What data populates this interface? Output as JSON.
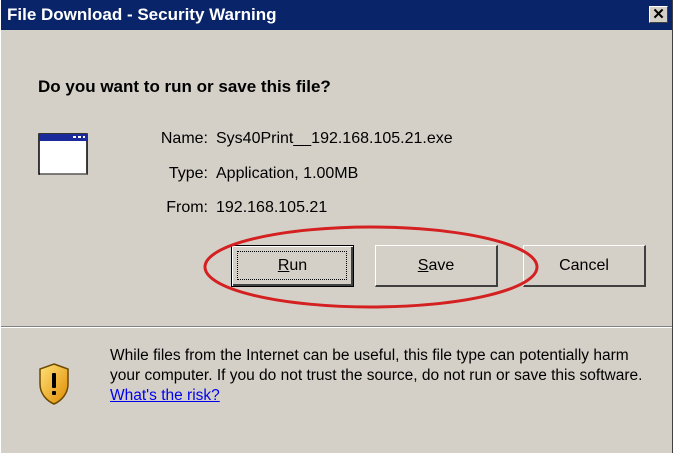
{
  "window": {
    "title": "File Download - Security Warning",
    "close_glyph": "✕"
  },
  "question": "Do you want to run or save this file?",
  "file": {
    "name_label": "Name:",
    "name_value": "Sys40Print__192.168.105.21.exe",
    "type_label": "Type:",
    "type_value": "Application, 1.00MB",
    "from_label": "From:",
    "from_value": "192.168.105.21",
    "icon": "application-window-icon"
  },
  "buttons": {
    "run": {
      "accel": "R",
      "rest": "un"
    },
    "save": {
      "accel": "S",
      "rest": "ave"
    },
    "cancel": "Cancel"
  },
  "highlight": {
    "color": "#d42020"
  },
  "warning": {
    "icon": "security-shield-icon",
    "text": "While files from the Internet can be useful, this file type can potentially harm your computer. If you do not trust the source, do not run or save this software. ",
    "link": "What's the risk?"
  },
  "colors": {
    "titlebar": "#0a246a",
    "dialog_bg": "#d4d0c8",
    "link": "#0000ee"
  }
}
